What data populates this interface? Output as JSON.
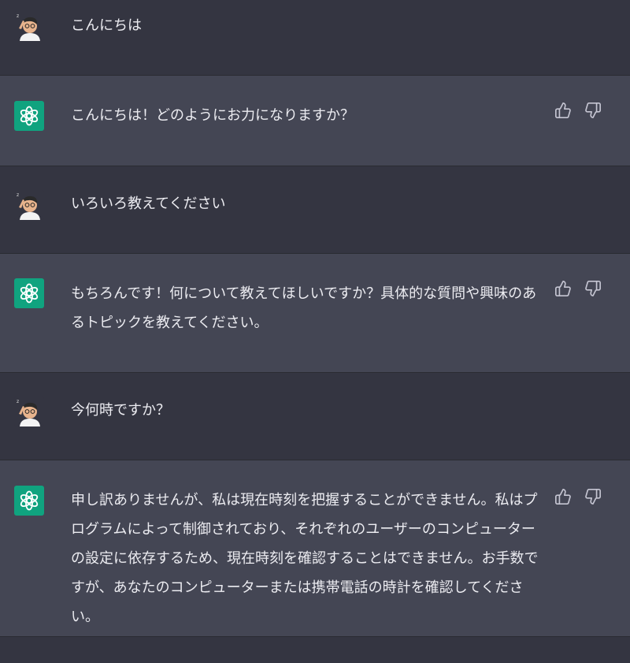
{
  "conversation": {
    "messages": [
      {
        "role": "user",
        "avatar_icon": "user-avatar-icon",
        "text": "こんにちは"
      },
      {
        "role": "assistant",
        "avatar_icon": "openai-logo-icon",
        "text": "こんにちは！どのようにお力になりますか？"
      },
      {
        "role": "user",
        "avatar_icon": "user-avatar-icon",
        "text": "いろいろ教えてください"
      },
      {
        "role": "assistant",
        "avatar_icon": "openai-logo-icon",
        "text": "もちろんです！何について教えてほしいですか？具体的な質問や興味のあるトピックを教えてください。"
      },
      {
        "role": "user",
        "avatar_icon": "user-avatar-icon",
        "text": "今何時ですか？"
      },
      {
        "role": "assistant",
        "avatar_icon": "openai-logo-icon",
        "text": "申し訳ありませんが、私は現在時刻を把握することができません。私はプログラムによって制御されており、それぞれのユーザーのコンピューターの設定に依存するため、現在時刻を確認することはできません。お手数ですが、あなたのコンピューターまたは携帯電話の時計を確認してください。"
      }
    ],
    "feedback_icons": [
      "thumbs-up-icon",
      "thumbs-down-icon"
    ]
  },
  "colors": {
    "user_bg": "#343541",
    "assistant_bg": "#444654",
    "accent": "#10a37f",
    "text": "#ececf1"
  }
}
